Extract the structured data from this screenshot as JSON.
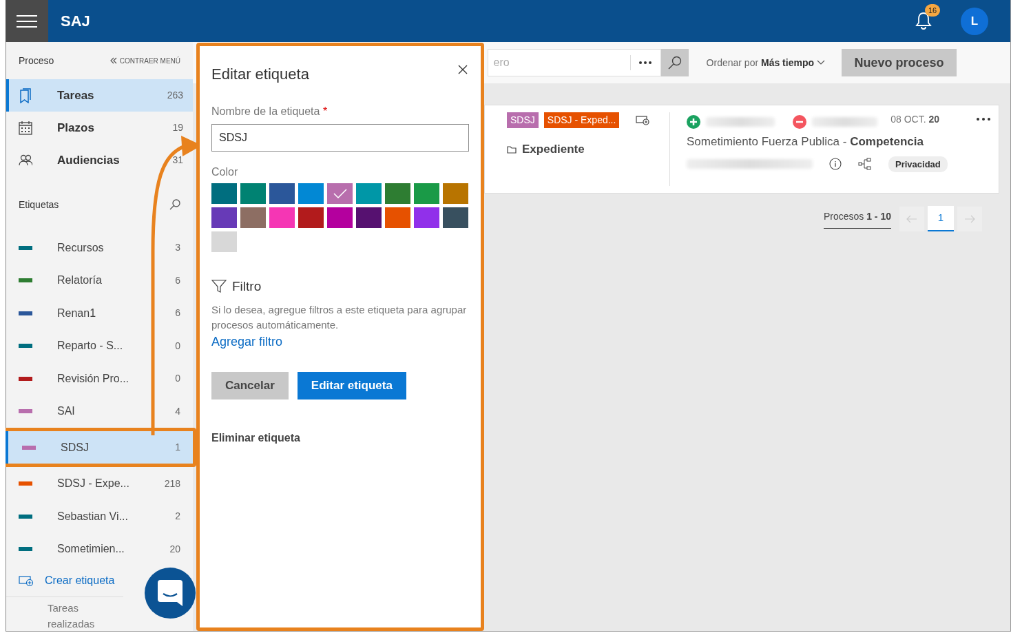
{
  "app": {
    "title": "SAJ",
    "notification_count": "16",
    "avatar": "L"
  },
  "sidebar": {
    "section": "Proceso",
    "collapse": "CONTRAER MENÚ",
    "nav": [
      {
        "kind": "bookmark",
        "label": "Tareas",
        "count": "263",
        "selected": true
      },
      {
        "kind": "calendar",
        "label": "Plazos",
        "count": "19",
        "selected": false
      },
      {
        "kind": "people",
        "label": "Audiencias",
        "count": "31",
        "selected": false
      }
    ],
    "labels_heading": "Etiquetas",
    "labels": [
      {
        "name": "Recursos",
        "count": "3",
        "color": "#006e7f",
        "selected": false
      },
      {
        "name": "Relatoría",
        "count": "6",
        "color": "#2e7d32",
        "selected": false
      },
      {
        "name": "Renan1",
        "count": "6",
        "color": "#2b579a",
        "selected": false
      },
      {
        "name": "Reparto - S...",
        "count": "0",
        "color": "#006e7f",
        "selected": false
      },
      {
        "name": "Revisión Pro...",
        "count": "0",
        "color": "#b21b1c",
        "selected": false
      },
      {
        "name": "SAI",
        "count": "4",
        "color": "#b86ead",
        "selected": false
      },
      {
        "name": "SDSJ",
        "count": "1",
        "color": "#b86ead",
        "selected": true
      },
      {
        "name": "SDSJ - Expe...",
        "count": "218",
        "color": "#e65100",
        "selected": false
      },
      {
        "name": "Sebastian Vi...",
        "count": "2",
        "color": "#006e7f",
        "selected": false
      },
      {
        "name": "Sometimien...",
        "count": "20",
        "color": "#006e7f",
        "selected": false
      }
    ],
    "create": "Crear etiqueta",
    "footer": "Tareas realizadas"
  },
  "toolbar": {
    "search_placeholder": "ero",
    "sort": "Ordenar por **Más tiempo**",
    "new_button": "Nuevo proceso"
  },
  "card": {
    "tags": [
      {
        "text": "SDSJ",
        "color": "#b86ead"
      },
      {
        "text": "SDSJ - Exped...",
        "color": "#e65100"
      }
    ],
    "type": "Expediente",
    "date": "08 OCT. **20**",
    "title": "Sometimiento Fuerza Publica - **Competencia**",
    "badge": "Privacidad"
  },
  "pagination": {
    "summary": "Procesos **1 - 10**",
    "pages": [
      {
        "label": "1",
        "selected": true
      }
    ]
  },
  "dialog": {
    "title": "Editar etiqueta",
    "name_label": "Nombre de la etiqueta",
    "required_mark": "*",
    "name_value": "SDSJ",
    "color_label": "Color",
    "colors": [
      {
        "color": "#006e7f",
        "selected": false
      },
      {
        "color": "#008272",
        "selected": false
      },
      {
        "color": "#2b579a",
        "selected": false
      },
      {
        "color": "#0288d4",
        "selected": false
      },
      {
        "color": "#b86ead",
        "selected": true
      },
      {
        "color": "#0097a7",
        "selected": false
      },
      {
        "color": "#2e7d32",
        "selected": false
      },
      {
        "color": "#1a9a47",
        "selected": false
      },
      {
        "color": "#b87400",
        "selected": false
      },
      {
        "color": "#673ab7",
        "selected": false
      },
      {
        "color": "#8d6e63",
        "selected": false
      },
      {
        "color": "#f536b4",
        "selected": false
      },
      {
        "color": "#b21b1c",
        "selected": false
      },
      {
        "color": "#b4009e",
        "selected": false
      },
      {
        "color": "#561170",
        "selected": false
      },
      {
        "color": "#e65100",
        "selected": false
      },
      {
        "color": "#9130ea",
        "selected": false
      },
      {
        "color": "#38505f",
        "selected": false
      },
      {
        "color": "#d8d8d8",
        "selected": false
      }
    ],
    "filter_title": "Filtro",
    "filter_text": "Si lo desea, agregue filtros a este etiqueta para agrupar procesos automáticamente.",
    "add_filter": "Agregar filtro",
    "cancel": "Cancelar",
    "submit": "Editar etiqueta",
    "delete": "Eliminar etiqueta"
  }
}
